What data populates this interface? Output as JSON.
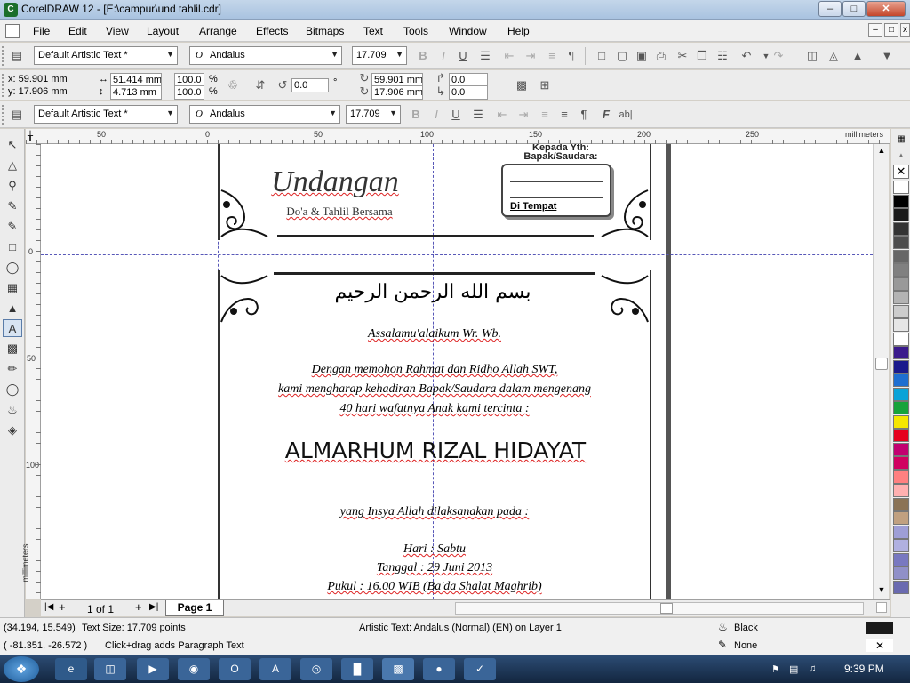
{
  "window": {
    "title": "CorelDRAW 12 - [E:\\campur\\und tahlil.cdr]"
  },
  "menu": [
    "File",
    "Edit",
    "View",
    "Layout",
    "Arrange",
    "Effects",
    "Bitmaps",
    "Text",
    "Tools",
    "Window",
    "Help"
  ],
  "text_toolbar": {
    "style": "Default Artistic Text *",
    "font": "Andalus",
    "size": "17.709"
  },
  "property_bar": {
    "x": "x: 59.901 mm",
    "y": "y: 17.906 mm",
    "width": "51.414 mm",
    "height": "4.713 mm",
    "scale_w": "100.0",
    "scale_h": "100.0",
    "pct1": "%",
    "pct2": "%",
    "rotation": "0.0",
    "deg": "°",
    "pos_x": "59.901 mm",
    "pos_y": "17.906 mm",
    "skew_h": "0.0",
    "skew_v": "0.0"
  },
  "text_toolbar2": {
    "style": "Default Artistic Text *",
    "font": "Andalus",
    "size": "17.709"
  },
  "ruler": {
    "h_labels": [
      "50",
      "0",
      "50",
      "100",
      "150",
      "200",
      "250"
    ],
    "unit": "millimeters",
    "v_labels": [
      "0",
      "50",
      "100"
    ],
    "v_unit": "millimeters"
  },
  "document": {
    "header_title": "Undangan",
    "header_subtitle": "Do'a & Tahlil Bersama",
    "address_to": "Kepada Yth:",
    "address_name": "Bapak/Saudara:",
    "address_place": "Di Tempat",
    "bismillah": "بسم الله الرحمن الرحيم",
    "greeting": "Assalamu'alaikum Wr. Wb.",
    "line1": "Dengan memohon Rahmat dan Ridho Allah SWT,",
    "line2": "kami mengharap kehadiran Bapak/Saudara dalam mengenang",
    "line3": "40 hari wafatnya Anak kami tercinta :",
    "name": "ALMARHUM RIZAL HIDAYAT",
    "line4": "yang Insya Allah dilaksanakan pada :",
    "day": "Hari : Sabtu",
    "date": "Tanggal : 29 Juni 2013",
    "time": "Pukul : 16.00 WIB (Ba'da Shalat Maghrib)"
  },
  "page_nav": {
    "count": "1 of 1",
    "tab": "Page 1"
  },
  "status": {
    "coords1": "(34.194, 15.549)",
    "text_size": "Text Size: 17.709 points",
    "coords2": "( -81.351, -26.572 )",
    "hint": "Click+drag adds Paragraph Text",
    "object_info": "Artistic Text: Andalus (Normal) (EN) on Layer 1",
    "fill": "Black",
    "outline": "None"
  },
  "taskbar": {
    "clock": "9:39 PM"
  },
  "colors": {
    "palette": [
      "#ffffff",
      "#000000",
      "#1a1a1a",
      "#333333",
      "#4d4d4d",
      "#666666",
      "#808080",
      "#999999",
      "#b3b3b3",
      "#cccccc",
      "#e6e6e6",
      "#ffffff",
      "#3a1a8c",
      "#1a1a8c",
      "#1e6fd1",
      "#0aa3d8",
      "#17a33a",
      "#f5e600",
      "#e6001e",
      "#c20070",
      "#d10060",
      "#ff8080",
      "#ffb0b0",
      "#8b7355",
      "#c0a080",
      "#9e9ed6",
      "#b0b0e0",
      "#7878c0",
      "#9090c8",
      "#6a6ab0"
    ]
  }
}
